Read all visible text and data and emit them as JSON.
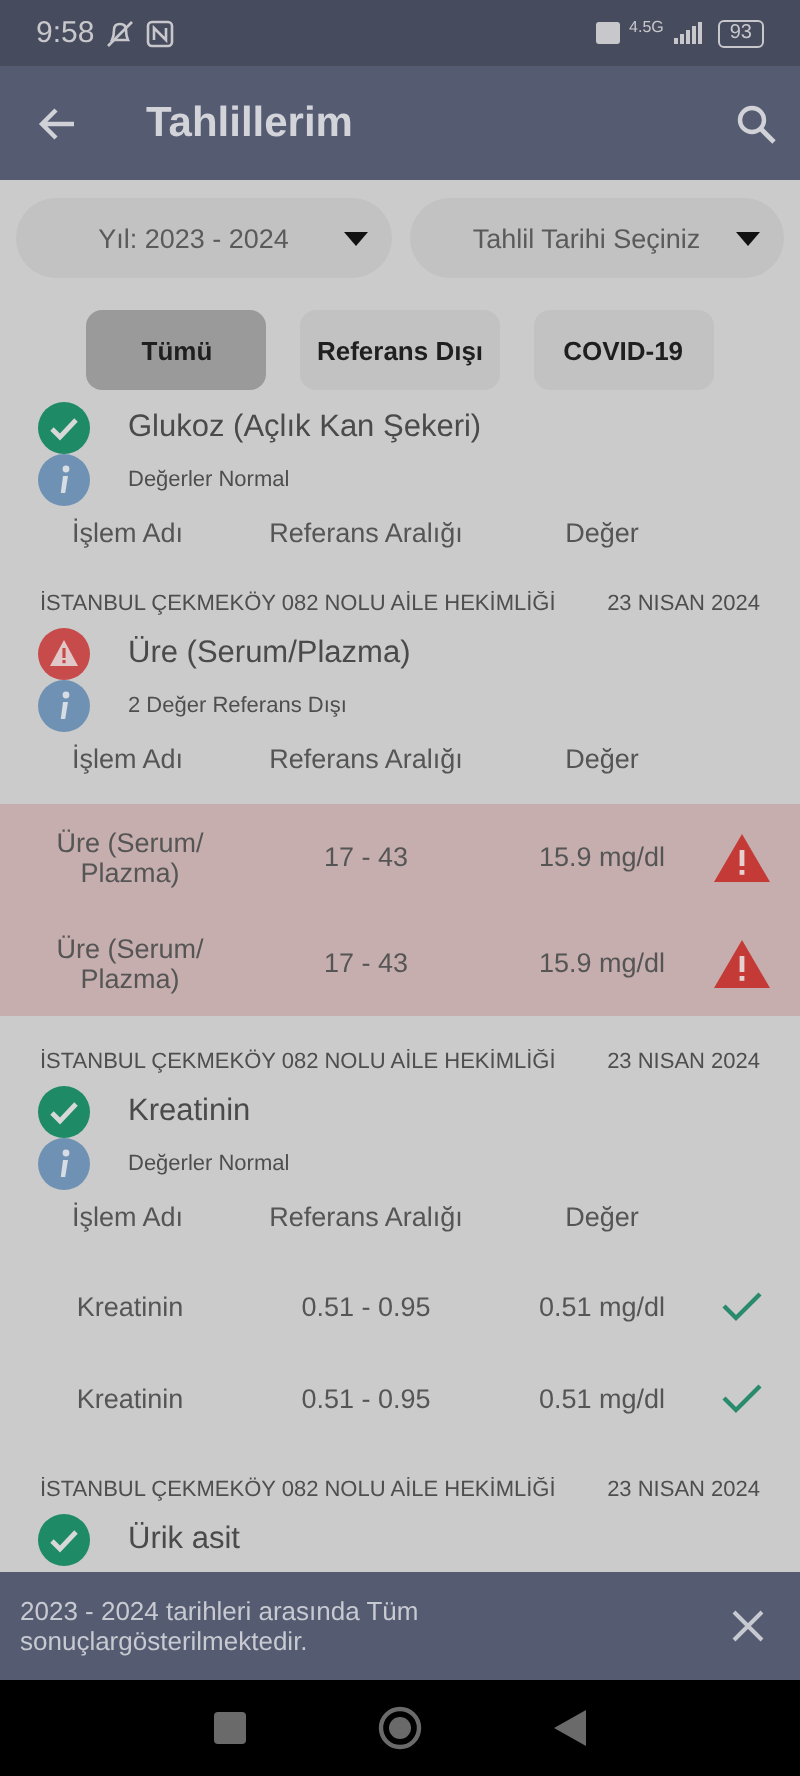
{
  "status_bar": {
    "time": "9:58",
    "network": "4.5G",
    "battery": "93"
  },
  "app_bar": {
    "title": "Tahlillerim"
  },
  "filters": [
    {
      "label": "Yıl: 2023 - 2024"
    },
    {
      "label": "Tahlil Tarihi Seçiniz"
    }
  ],
  "tabs": [
    {
      "label": "Tümü",
      "selected": true
    },
    {
      "label": "Referans Dışı",
      "selected": false
    },
    {
      "label": "COVID-19",
      "selected": false
    }
  ],
  "tests": [
    {
      "name": "Glukoz (Açlık Kan Şekeri)",
      "abnormal": false,
      "summary": "Değerler Normal",
      "columns": [
        "İşlem Adı",
        "Referans Aralığı",
        "Değer"
      ]
    },
    {
      "facility": "İSTANBUL ÇEKMEKÖY 082 NOLU AİLE HEKİMLİĞİ",
      "date": "23 NISAN 2024",
      "name": "Üre (Serum/Plazma)",
      "abnormal": true,
      "summary": "2 Değer Referans Dışı",
      "columns": [
        "İşlem Adı",
        "Referans Aralığı",
        "Değer"
      ],
      "rows": [
        {
          "name": "Üre (Serum/ Plazma)",
          "range": "17 - 43",
          "value": "15.9 mg/dl",
          "out_of_range": true
        },
        {
          "name": "Üre (Serum/ Plazma)",
          "range": "17 - 43",
          "value": "15.9 mg/dl",
          "out_of_range": true
        }
      ]
    },
    {
      "facility": "İSTANBUL ÇEKMEKÖY 082 NOLU AİLE HEKİMLİĞİ",
      "date": "23 NISAN 2024",
      "name": "Kreatinin",
      "abnormal": false,
      "summary": "Değerler Normal",
      "columns": [
        "İşlem Adı",
        "Referans Aralığı",
        "Değer"
      ],
      "rows": [
        {
          "name": "Kreatinin",
          "range": "0.51 - 0.95",
          "value": "0.51 mg/dl",
          "out_of_range": false
        },
        {
          "name": "Kreatinin",
          "range": "0.51 - 0.95",
          "value": "0.51 mg/dl",
          "out_of_range": false
        }
      ]
    },
    {
      "facility": "İSTANBUL ÇEKMEKÖY 082 NOLU AİLE HEKİMLİĞİ",
      "date": "23 NISAN 2024",
      "name": "Ürik asit",
      "abnormal": false
    }
  ],
  "snackbar": {
    "message": "2023 - 2024 tarihleri arasında Tüm sonuçlargösterilmektedir."
  }
}
